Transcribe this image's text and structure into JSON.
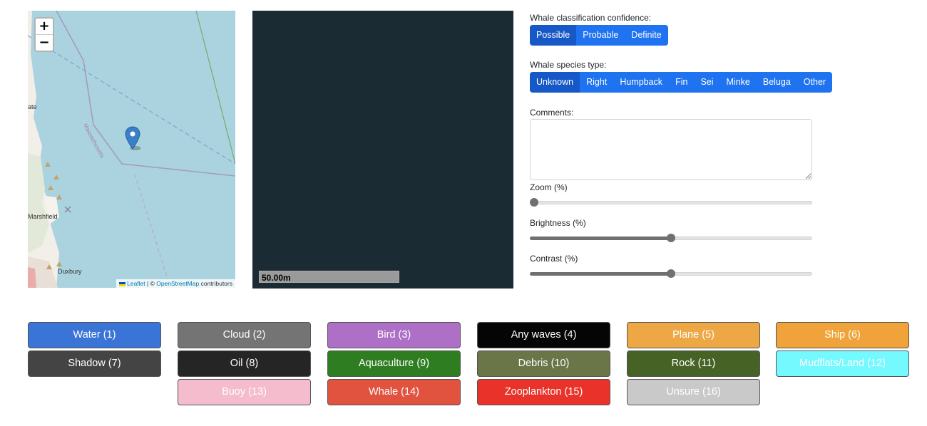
{
  "map": {
    "zoom_in_label": "+",
    "zoom_out_label": "−",
    "place_labels": [
      "ate",
      "Massachusetts",
      "Marshfield",
      "Duxbury"
    ],
    "attribution": {
      "leaflet": "Leaflet",
      "separator": " | © ",
      "osm": "OpenStreetMap",
      "suffix": " contributors"
    },
    "marker_icon": "map-marker-icon"
  },
  "image_panel": {
    "scale_label": "50.00m"
  },
  "confidence": {
    "label": "Whale classification confidence:",
    "options": [
      "Possible",
      "Probable",
      "Definite"
    ],
    "selected": "Possible"
  },
  "species": {
    "label": "Whale species type:",
    "options": [
      "Unknown",
      "Right",
      "Humpback",
      "Fin",
      "Sei",
      "Minke",
      "Beluga",
      "Other"
    ],
    "selected": "Unknown"
  },
  "comments": {
    "label": "Comments:",
    "value": ""
  },
  "sliders": {
    "zoom": {
      "label": "Zoom (%)",
      "value_fraction": 0.0
    },
    "brightness": {
      "label": "Brightness (%)",
      "value_fraction": 0.5
    },
    "contrast": {
      "label": "Contrast (%)",
      "value_fraction": 0.5
    }
  },
  "categories": [
    {
      "label": "Water (1)",
      "bg": "#3a74d6",
      "fg": "#ffffff"
    },
    {
      "label": "Cloud (2)",
      "bg": "#747474",
      "fg": "#ffffff"
    },
    {
      "label": "Bird (3)",
      "bg": "#ae6fc6",
      "fg": "#ffffff"
    },
    {
      "label": "Any waves (4)",
      "bg": "#050505",
      "fg": "#ffffff"
    },
    {
      "label": "Plane (5)",
      "bg": "#eea745",
      "fg": "#ffffff"
    },
    {
      "label": "Ship (6)",
      "bg": "#f0a33a",
      "fg": "#ffffff"
    },
    {
      "label": "Shadow (7)",
      "bg": "#444444",
      "fg": "#ffffff"
    },
    {
      "label": "Oil (8)",
      "bg": "#252525",
      "fg": "#ffffff"
    },
    {
      "label": "Aquaculture (9)",
      "bg": "#2f7d21",
      "fg": "#ffffff"
    },
    {
      "label": "Debris (10)",
      "bg": "#6a7548",
      "fg": "#ffffff"
    },
    {
      "label": "Rock (11)",
      "bg": "#466325",
      "fg": "#ffffff"
    },
    {
      "label": "Mudflats/Land (12)",
      "bg": "#74f9ff",
      "fg": "#ffffff"
    },
    {
      "label": "Buoy (13)",
      "bg": "#f4bccc",
      "fg": "#ffffff"
    },
    {
      "label": "Whale (14)",
      "bg": "#e1533f",
      "fg": "#ffffff"
    },
    {
      "label": "Zooplankton (15)",
      "bg": "#e9322a",
      "fg": "#ffffff"
    },
    {
      "label": "Unsure (16)",
      "bg": "#c9c9c9",
      "fg": "#ffffff"
    }
  ]
}
